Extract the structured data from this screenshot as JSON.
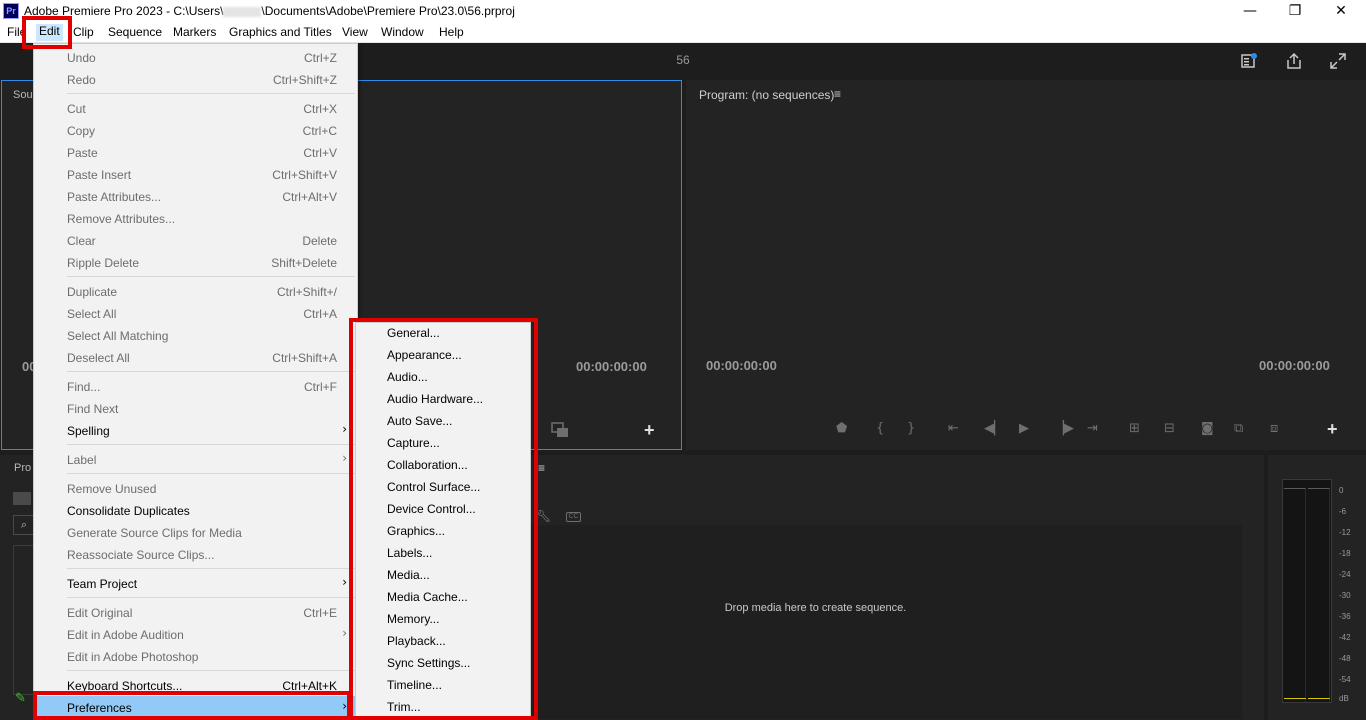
{
  "window": {
    "title": "Adobe Premiere Pro 2023 - C:\\Users\\",
    "title_tail": "\\Documents\\Adobe\\Premiere Pro\\23.0\\56.prproj",
    "app_icon": "Pr",
    "minimize": "—",
    "restore": "❐",
    "close": "✕"
  },
  "menubar": {
    "items": [
      "File",
      "Edit",
      "Clip",
      "Sequence",
      "Markers",
      "Graphics and Titles",
      "View",
      "Window",
      "Help"
    ]
  },
  "workspace": {
    "title": "56",
    "icons": [
      "quick-export-icon",
      "share-icon",
      "fullscreen-icon"
    ]
  },
  "source_panel": {
    "tab_label": "Sou",
    "timecode_left": "00",
    "timecode_right": "00:00:00:00",
    "add_button": "+"
  },
  "program_panel": {
    "title": "Program: (no sequences)",
    "menu_icon": "≡",
    "timecode_left": "00:00:00:00",
    "timecode_right": "00:00:00:00",
    "add_button": "+",
    "controls": [
      "add-marker-icon",
      "mark-in-icon",
      "mark-out-icon",
      "go-to-in-icon",
      "step-back-icon",
      "play-icon",
      "step-forward-icon",
      "go-to-out-icon",
      "lift-icon",
      "extract-icon",
      "export-frame-icon",
      "comparison-view-icon",
      "toggle-proxies-icon"
    ]
  },
  "project_panel": {
    "tab_label": "Pro"
  },
  "timeline_panel": {
    "drop_text": "Drop media here to create sequence.",
    "menu_icon": "≡"
  },
  "audio_meter": {
    "ticks": [
      "0",
      "-6",
      "-12",
      "-18",
      "-24",
      "-30",
      "-36",
      "-42",
      "-48",
      "-54",
      "dB"
    ]
  },
  "edit_menu": {
    "items": [
      {
        "label": "Undo",
        "shortcut": "Ctrl+Z",
        "enabled": false
      },
      {
        "label": "Redo",
        "shortcut": "Ctrl+Shift+Z",
        "enabled": false
      },
      {
        "label": "Cut",
        "shortcut": "Ctrl+X",
        "enabled": false
      },
      {
        "label": "Copy",
        "shortcut": "Ctrl+C",
        "enabled": false
      },
      {
        "label": "Paste",
        "shortcut": "Ctrl+V",
        "enabled": false
      },
      {
        "label": "Paste Insert",
        "shortcut": "Ctrl+Shift+V",
        "enabled": false
      },
      {
        "label": "Paste Attributes...",
        "shortcut": "Ctrl+Alt+V",
        "enabled": false
      },
      {
        "label": "Remove Attributes...",
        "shortcut": "",
        "enabled": false
      },
      {
        "label": "Clear",
        "shortcut": "Delete",
        "enabled": false
      },
      {
        "label": "Ripple Delete",
        "shortcut": "Shift+Delete",
        "enabled": false
      },
      {
        "label": "Duplicate",
        "shortcut": "Ctrl+Shift+/",
        "enabled": false
      },
      {
        "label": "Select All",
        "shortcut": "Ctrl+A",
        "enabled": false
      },
      {
        "label": "Select All Matching",
        "shortcut": "",
        "enabled": false
      },
      {
        "label": "Deselect All",
        "shortcut": "Ctrl+Shift+A",
        "enabled": false
      },
      {
        "label": "Find...",
        "shortcut": "Ctrl+F",
        "enabled": false
      },
      {
        "label": "Find Next",
        "shortcut": "",
        "enabled": false
      },
      {
        "label": "Spelling",
        "shortcut": "",
        "enabled": true,
        "submenu": true
      },
      {
        "label": "Label",
        "shortcut": "",
        "enabled": false,
        "submenu": true
      },
      {
        "label": "Remove Unused",
        "shortcut": "",
        "enabled": false
      },
      {
        "label": "Consolidate Duplicates",
        "shortcut": "",
        "enabled": true
      },
      {
        "label": "Generate Source Clips for Media",
        "shortcut": "",
        "enabled": false
      },
      {
        "label": "Reassociate Source Clips...",
        "shortcut": "",
        "enabled": false
      },
      {
        "label": "Team Project",
        "shortcut": "",
        "enabled": true,
        "submenu": true
      },
      {
        "label": "Edit Original",
        "shortcut": "Ctrl+E",
        "enabled": false
      },
      {
        "label": "Edit in Adobe Audition",
        "shortcut": "",
        "enabled": false,
        "submenu": true
      },
      {
        "label": "Edit in Adobe Photoshop",
        "shortcut": "",
        "enabled": false
      },
      {
        "label": "Keyboard Shortcuts...",
        "shortcut": "Ctrl+Alt+K",
        "enabled": true
      },
      {
        "label": "Preferences",
        "shortcut": "",
        "enabled": true,
        "submenu": true
      }
    ],
    "arrow": "›"
  },
  "preferences_menu": {
    "items": [
      "General...",
      "Appearance...",
      "Audio...",
      "Audio Hardware...",
      "Auto Save...",
      "Capture...",
      "Collaboration...",
      "Control Surface...",
      "Device Control...",
      "Graphics...",
      "Labels...",
      "Media...",
      "Media Cache...",
      "Memory...",
      "Playback...",
      "Sync Settings...",
      "Timeline...",
      "Trim..."
    ]
  },
  "colors": {
    "highlight_box": "#e00000",
    "selected_item": "#91c9f7",
    "panel_focus_border": "#2d8ceb",
    "menu_bg": "#f2f2f2"
  }
}
